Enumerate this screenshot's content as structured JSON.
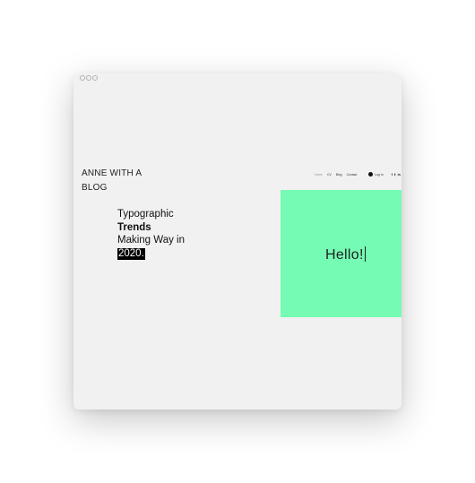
{
  "blog": {
    "title": "ANNE WITH A BLOG"
  },
  "nav": {
    "items": [
      "Home",
      "CV",
      "Blog",
      "Contact"
    ],
    "login_label": "Log In",
    "social_icons": [
      "facebook-icon",
      "twitter-icon",
      "linkedin-icon",
      "instagram-icon"
    ],
    "social_glyphs": [
      "f",
      "𝕥",
      "in",
      "◎"
    ]
  },
  "headline": {
    "line1": "Typographic",
    "line2": "Trends",
    "line3": "Making Way in",
    "line4": "2020."
  },
  "hero": {
    "text": "Hello!",
    "background_color": "#75fbb4"
  }
}
